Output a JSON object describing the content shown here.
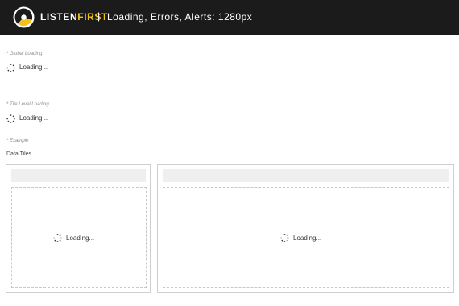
{
  "header": {
    "brand_part1": "LISTEN",
    "brand_part2": "FIRST",
    "separator": "|",
    "title": "Loading, Errors, Alerts: 1280px",
    "logo_icon": "listenfirst-logo-icon"
  },
  "sections": {
    "global": {
      "note": "* Global Loading",
      "loading_text": "Loading..."
    },
    "tile_level": {
      "note": "* Tile Level Loading",
      "loading_text": "Loading..."
    },
    "example": {
      "note": "* Example",
      "label": "Data Tiles"
    }
  },
  "tiles": [
    {
      "loading_text": "Loading..."
    },
    {
      "loading_text": "Loading..."
    }
  ],
  "colors": {
    "header_bg": "#1b1b1b",
    "brand_accent": "#f2c21b",
    "tile_header_bg": "#efefef"
  }
}
